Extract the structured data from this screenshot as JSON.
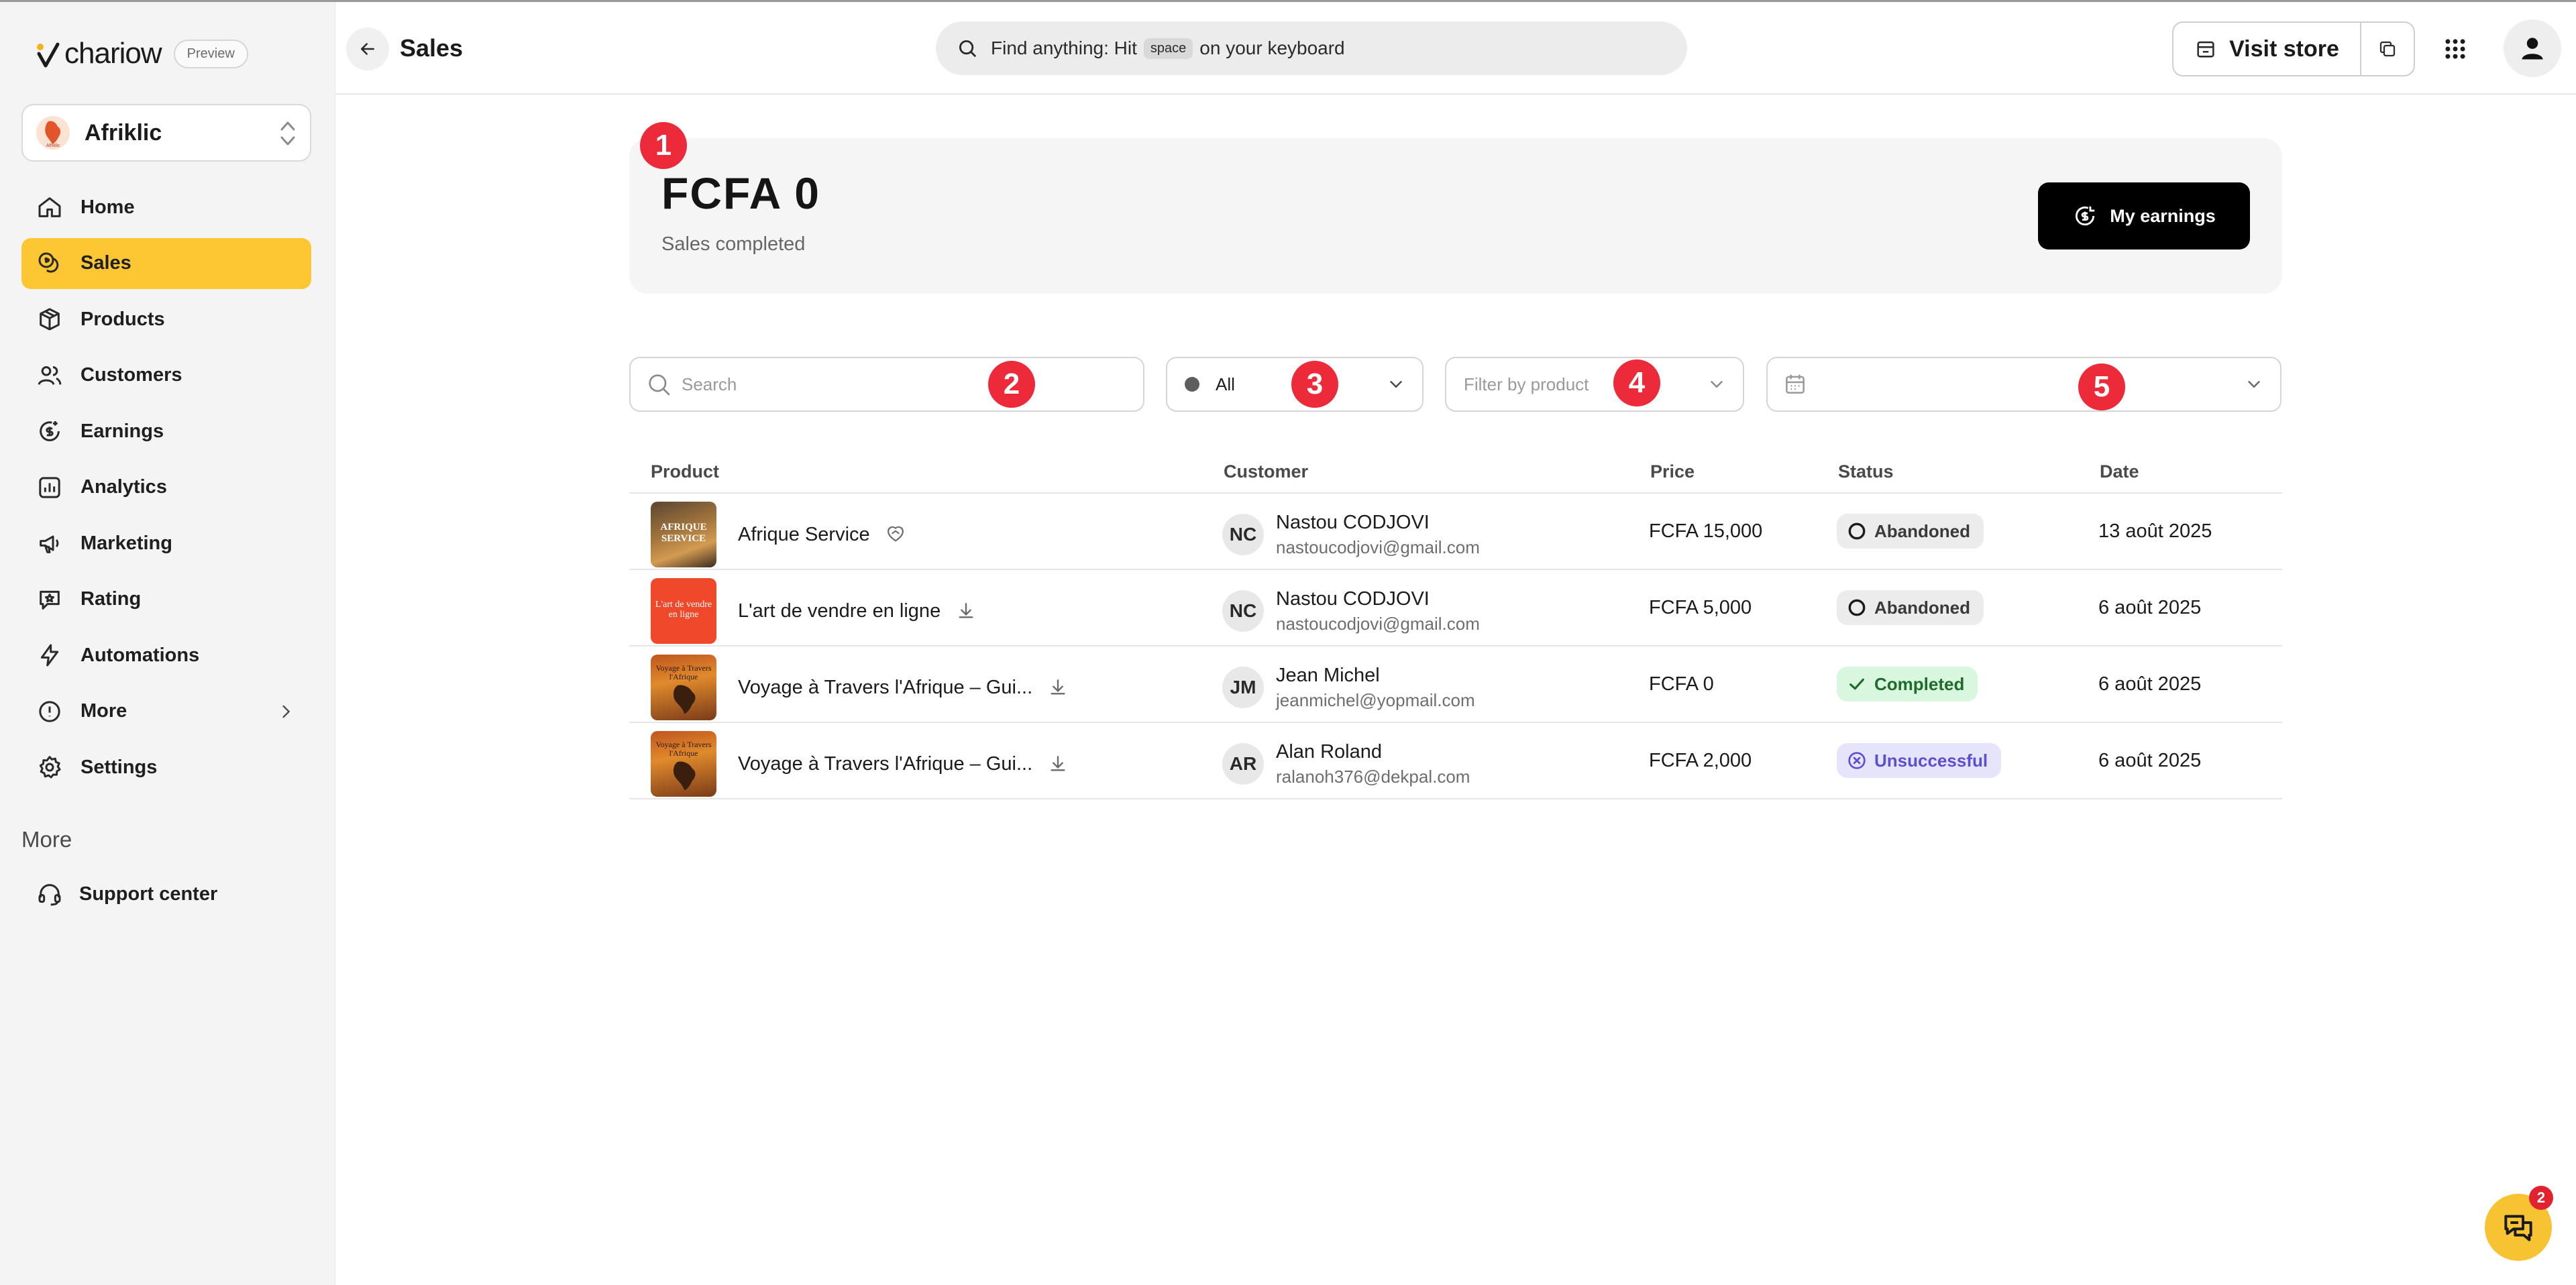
{
  "brand": {
    "name": "chariow",
    "badge": "Preview"
  },
  "workspace": {
    "name": "Afriklic",
    "avatar_text": "Afriklic"
  },
  "sidebar": {
    "items": [
      {
        "label": "Home",
        "icon": "home-icon",
        "active": false
      },
      {
        "label": "Sales",
        "icon": "coins-icon",
        "active": true
      },
      {
        "label": "Products",
        "icon": "box-icon",
        "active": false
      },
      {
        "label": "Customers",
        "icon": "users-icon",
        "active": false
      },
      {
        "label": "Earnings",
        "icon": "dollar-circle-icon",
        "active": false
      },
      {
        "label": "Analytics",
        "icon": "bar-chart-icon",
        "active": false
      },
      {
        "label": "Marketing",
        "icon": "megaphone-icon",
        "active": false
      },
      {
        "label": "Rating",
        "icon": "message-star-icon",
        "active": false
      },
      {
        "label": "Automations",
        "icon": "lightning-icon",
        "active": false
      },
      {
        "label": "More",
        "icon": "info-circle-icon",
        "active": false
      },
      {
        "label": "Settings",
        "icon": "gear-icon",
        "active": false
      }
    ],
    "section_title": "More",
    "support_label": "Support center"
  },
  "header": {
    "title": "Sales",
    "search_prefix": "Find anything: Hit",
    "search_key": "space",
    "search_suffix": "on your keyboard",
    "visit_store_label": "Visit store"
  },
  "summary": {
    "amount": "FCFA 0",
    "label": "Sales completed",
    "earnings_button": "My earnings"
  },
  "filters": {
    "search_placeholder": "Search",
    "status_value": "All",
    "product_placeholder": "Filter by product",
    "date_value": ""
  },
  "markers": [
    "1",
    "2",
    "3",
    "4",
    "5"
  ],
  "table": {
    "columns": [
      "Product",
      "Customer",
      "Price",
      "Status",
      "Date"
    ],
    "rows": [
      {
        "product": "Afrique Service",
        "product_icon": "membership-icon",
        "thumb_text": "AFRIQUE SERVICE",
        "initials": "NC",
        "customer": "Nastou CODJOVI",
        "email": "nastoucodjovi@gmail.com",
        "price": "FCFA 15,000",
        "status": "Abandoned",
        "date": "13 août 2025"
      },
      {
        "product": "L'art de vendre en ligne",
        "product_icon": "download-icon",
        "thumb_text": "L'art de vendre en ligne",
        "initials": "NC",
        "customer": "Nastou CODJOVI",
        "email": "nastoucodjovi@gmail.com",
        "price": "FCFA 5,000",
        "status": "Abandoned",
        "date": "6 août 2025"
      },
      {
        "product": "Voyage à Travers l'Afrique – Gui...",
        "product_icon": "download-icon",
        "thumb_text": "Voyage à Travers l'Afrique",
        "initials": "JM",
        "customer": "Jean Michel",
        "email": "jeanmichel@yopmail.com",
        "price": "FCFA 0",
        "status": "Completed",
        "date": "6 août 2025"
      },
      {
        "product": "Voyage à Travers l'Afrique – Gui...",
        "product_icon": "download-icon",
        "thumb_text": "Voyage à Travers l'Afrique",
        "initials": "AR",
        "customer": "Alan Roland",
        "email": "ralanoh376@dekpal.com",
        "price": "FCFA 2,000",
        "status": "Unsuccessful",
        "date": "6 août 2025"
      }
    ]
  },
  "chat": {
    "unread_count": "2"
  },
  "colors": {
    "accent": "#fdc734",
    "marker": "#ec2a3a",
    "completed": "#d9f6de",
    "unsuccessful": "#e6e4fb"
  }
}
